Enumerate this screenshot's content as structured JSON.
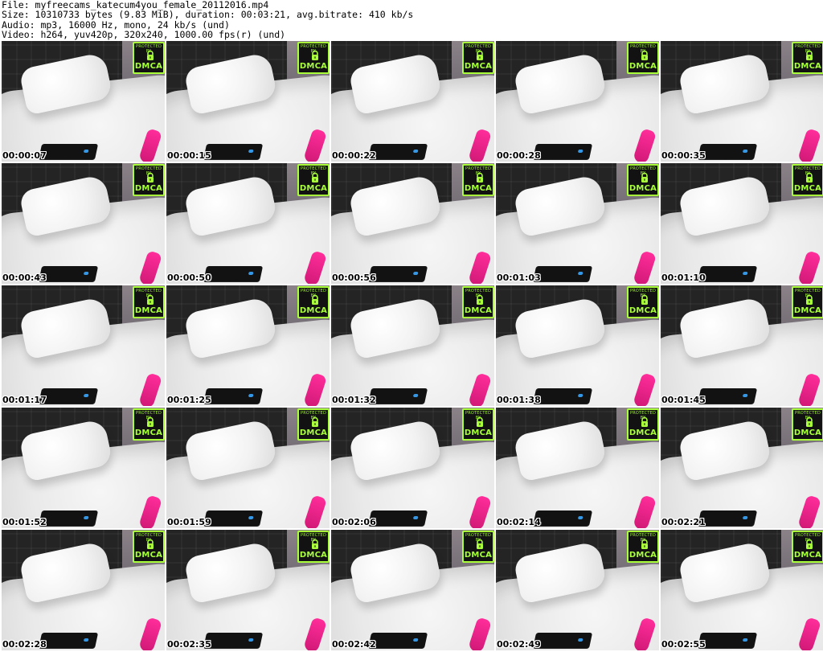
{
  "header": {
    "line1": "File: myfreecams_katecum4you_female_20112016.mp4",
    "line2": "Size: 10310733 bytes (9.83 MiB), duration: 00:03:21, avg.bitrate: 410 kb/s",
    "line3": "Audio: mp3, 16000 Hz, mono, 24 kb/s (und)",
    "line4": "Video: h264, yuv420p, 320x240, 1000.00 fps(r) (und)"
  },
  "watermark": {
    "protected_by": "PROTECTED BY",
    "brand": "DMCA",
    "color": "#a8ff3a",
    "icon": "lock-icon"
  },
  "thumbnails": [
    {
      "time": "00:00:07"
    },
    {
      "time": "00:00:15"
    },
    {
      "time": "00:00:22"
    },
    {
      "time": "00:00:28"
    },
    {
      "time": "00:00:35"
    },
    {
      "time": "00:00:43"
    },
    {
      "time": "00:00:50"
    },
    {
      "time": "00:00:56"
    },
    {
      "time": "00:01:03"
    },
    {
      "time": "00:01:10"
    },
    {
      "time": "00:01:17"
    },
    {
      "time": "00:01:25"
    },
    {
      "time": "00:01:32"
    },
    {
      "time": "00:01:38"
    },
    {
      "time": "00:01:45"
    },
    {
      "time": "00:01:52"
    },
    {
      "time": "00:01:59"
    },
    {
      "time": "00:02:06"
    },
    {
      "time": "00:02:14"
    },
    {
      "time": "00:02:21"
    },
    {
      "time": "00:02:28"
    },
    {
      "time": "00:02:35"
    },
    {
      "time": "00:02:42"
    },
    {
      "time": "00:02:49"
    },
    {
      "time": "00:02:55"
    }
  ]
}
